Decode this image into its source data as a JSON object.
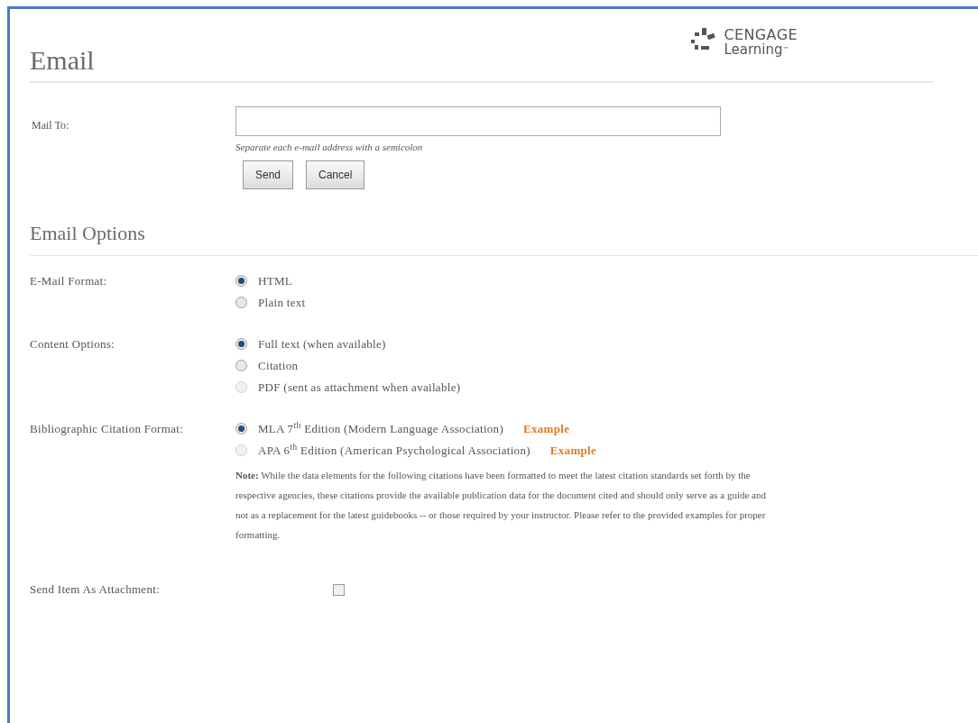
{
  "title": "Email",
  "logo": {
    "line1": "CENGAGE",
    "line2": "Learning",
    "mark": "™"
  },
  "mail_to": {
    "label": "Mail To:",
    "hint": "Separate each e-mail address with a semicolon"
  },
  "buttons": [
    "Send",
    "Cancel"
  ],
  "options_title": "Email Options",
  "groups": [
    {
      "label": "E-Mail Format:",
      "options": [
        {
          "text": "HTML",
          "selected": true,
          "disabled": false
        },
        {
          "text": "Plain text",
          "selected": false,
          "disabled": false
        }
      ]
    },
    {
      "label": "Content Options:",
      "options": [
        {
          "text": "Full text (when available)",
          "selected": true,
          "disabled": false
        },
        {
          "text": "Citation",
          "selected": false,
          "disabled": false
        },
        {
          "text": "PDF (sent as attachment when available)",
          "selected": false,
          "disabled": true
        }
      ]
    },
    {
      "label": "Bibliographic Citation Format:",
      "options": [
        {
          "text": "MLA 7$^{th}$ Edition (Modern Language Association)",
          "link": "Example",
          "selected": true,
          "disabled": false
        },
        {
          "text": "APA 6$^{th}$ Edition (American Psychological Association)",
          "link": "Example",
          "selected": false,
          "disabled": true
        }
      ],
      "note": "**Note:** While the data elements for the following citations have been formatted to meet the latest citation standards set forth by the respective agencies, these citations provide the available publication data for the document cited and should only serve as a guide and not as a replacement for the latest guidebooks -- or those required by your instructor. Please refer to the provided examples for proper formatting."
    }
  ],
  "attachment": {
    "label": "Send Item As Attachment:",
    "checked": false
  }
}
